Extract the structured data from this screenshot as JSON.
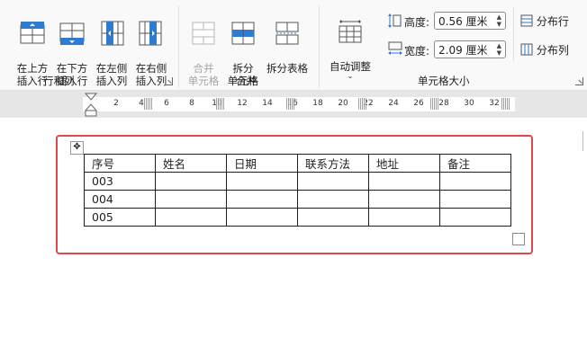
{
  "ribbon": {
    "rows_cols": {
      "insert_above": "在上方\n插入行",
      "insert_below": "在下方\n插入行",
      "insert_left": "在左侧\n插入列",
      "insert_right": "在右侧\n插入列",
      "group_label": "行和列"
    },
    "merge": {
      "merge_cells": "合并\n单元格",
      "split_cells": "拆分\n单元格",
      "split_table": "拆分表格",
      "group_label": "合并"
    },
    "cell_size": {
      "autofit": "自动调整",
      "height_label": "高度:",
      "height_value": "0.56 厘米",
      "width_label": "宽度:",
      "width_value": "2.09 厘米",
      "distribute_rows": "分布行",
      "distribute_cols": "分布列",
      "group_label": "单元格大小"
    }
  },
  "ruler": {
    "numbers": [
      "2",
      "4",
      "6",
      "8",
      "10",
      "12",
      "14",
      "16",
      "18",
      "20",
      "22",
      "24",
      "26",
      "28",
      "30",
      "32"
    ]
  },
  "table": {
    "headers": [
      "序号",
      "姓名",
      "日期",
      "联系方法",
      "地址",
      "备注"
    ],
    "rows": [
      [
        "003",
        "",
        "",
        "",
        "",
        ""
      ],
      [
        "004",
        "",
        "",
        "",
        "",
        ""
      ],
      [
        "005",
        "",
        "",
        "",
        "",
        ""
      ]
    ]
  },
  "colors": {
    "highlight_border": "#e0474c",
    "icon_blue": "#2f7bd1"
  }
}
